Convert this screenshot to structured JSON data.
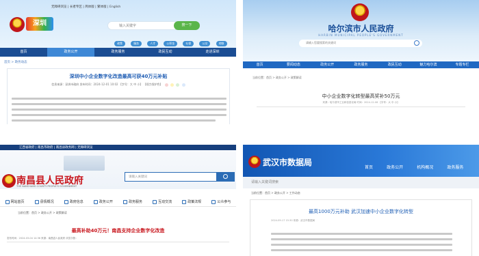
{
  "panel1": {
    "top_links": "无障碍浏览 | 长者专区 | 简体版 | 繁体版 | English",
    "logo_text": "深圳",
    "search_placeholder": "输入关键字",
    "search_button": "搜一下",
    "hot_tags": [
      "政策",
      "服务",
      "人才",
      "公积金",
      "社保",
      "公交",
      "地铁"
    ],
    "nav": [
      {
        "label": "首页",
        "active": false
      },
      {
        "label": "政务公开",
        "active": true
      },
      {
        "label": "政务服务",
        "active": false
      },
      {
        "label": "政民互动",
        "active": false
      },
      {
        "label": "走进深圳",
        "active": false
      }
    ],
    "breadcrumb": "首页 > 政务动态",
    "article_title": "深圳中小企业数字化改造最高可获40万元补贴",
    "meta": "信息来源：深圳市政府   发布时间：2024-12-01 10:02   【字号：大 中 小】   【视力保护色】"
  },
  "panel2": {
    "title": "哈尔滨市人民政府",
    "subtitle": "HARBIN MUNICIPAL PEOPLE'S GOVERNMENT",
    "search_placeholder": "请输入您要搜索的关键词",
    "nav": [
      "首页",
      "要闻动态",
      "政务公开",
      "政务服务",
      "政民互动",
      "魅力哈尔滨",
      "专题专栏"
    ],
    "breadcrumb": "当前位置：首页 > 政务公开 > 政策解读",
    "article_title": "中小企业数字化转型最高奖补50万元",
    "meta": "来源：哈尔滨市工业和信息化局   时间：2024-12-06   【字号：大 中 小】"
  },
  "panel3": {
    "top_bar": "江西省政府 | 南昌市政府 | 南昌县政务网 | 无障碍浏览",
    "title": "南昌县人民政府",
    "subtitle": "THE NANCHANG COUNTY PEOPLE'S GOVERNMENT",
    "search_placeholder": "请输入关键词",
    "nav": [
      "网站首页",
      "县情概况",
      "政府信息",
      "政务公开",
      "政务服务",
      "互动交流",
      "政策法规",
      "公众参与"
    ],
    "breadcrumb": "当前位置：首页 > 政务公开 > 政策解读",
    "article_title": "最高补助40万元！南昌支持企业数字化改造",
    "meta": "发布时间：2024-03-04 14:36   来源：南昌县人民政府   浏览次数："
  },
  "panel4": {
    "title": "武汉市数据局",
    "nav": [
      "首页",
      "政务公开",
      "机构概况",
      "政务服务"
    ],
    "search_placeholder": "请输入关键词搜索",
    "breadcrumb": "当前位置：首页 > 政务公开 > 工作动态",
    "article_title": "最高1000万元补助 武汉加速中小企业数字化转型",
    "meta": "2024-09-17 15:30   来源：武汉市数据局"
  }
}
